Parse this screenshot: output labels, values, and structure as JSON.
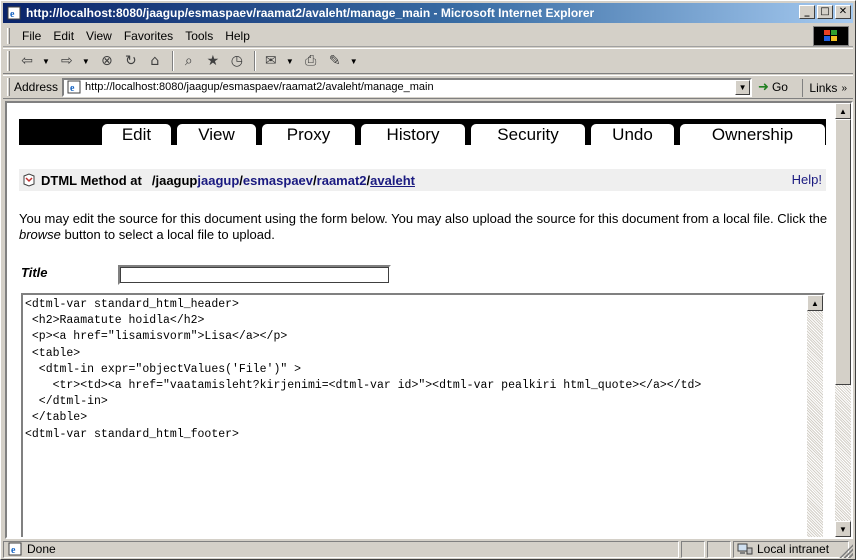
{
  "window": {
    "title": "http://localhost:8080/jaagup/esmaspaev/raamat2/avaleht/manage_main - Microsoft Internet Explorer",
    "buttons": {
      "minimize": "_",
      "maximize": "□",
      "close": "✕"
    }
  },
  "menubar": {
    "items": [
      "File",
      "Edit",
      "View",
      "Favorites",
      "Tools",
      "Help"
    ]
  },
  "toolbar": {
    "back": "⇦",
    "forward": "⇨",
    "stop": "⊗",
    "refresh": "↻",
    "home": "⌂",
    "search": "⌕",
    "favorites": "★",
    "history": "◷",
    "mail": "✉",
    "print": "⎙",
    "edit": "✎",
    "dropdown": "▼"
  },
  "addressbar": {
    "label": "Address",
    "url": "http://localhost:8080/jaagup/esmaspaev/raamat2/avaleht/manage_main",
    "go_label": "Go",
    "go_arrow": "➜",
    "links_label": "Links",
    "links_chevron": "»"
  },
  "tabs": [
    {
      "label": "Edit",
      "active": true
    },
    {
      "label": "View"
    },
    {
      "label": "Proxy"
    },
    {
      "label": "History"
    },
    {
      "label": "Security"
    },
    {
      "label": "Undo"
    },
    {
      "label": "Ownership"
    }
  ],
  "crumb": {
    "type_label": "DTML Method at",
    "path": [
      "/jaagup",
      "/esmaspaev",
      "/raamat2",
      "/"
    ],
    "path_parts": {
      "p1": "jaagup",
      "p2": "esmaspaev",
      "p3": "raamat2",
      "last": "avaleht"
    },
    "help": "Help!"
  },
  "instructions": {
    "line_a": "You may edit the source for this document using the form below. You may also upload the source for this document from a local file. Click the ",
    "browse_word": "browse",
    "line_b": " button to select a local file to upload."
  },
  "form": {
    "title_label": "Title",
    "title_value": "",
    "source_lines": [
      "<dtml-var standard_html_header>",
      " <h2>Raamatute hoidla</h2>",
      " <p><a href=\"lisamisvorm\">Lisa</a></p>",
      " <table>",
      "  <dtml-in expr=\"objectValues('File')\" >",
      "    <tr><td><a href=\"vaatamisleht?kirjenimi=<dtml-var id>\"><dtml-var pealkiri html_quote></a></td>",
      "  </dtml-in>",
      " </table>",
      "<dtml-var standard_html_footer>"
    ]
  },
  "statusbar": {
    "text": "Done",
    "zone": "Local intranet"
  },
  "colors": {
    "titlebar_start": "#0a246a",
    "titlebar_end": "#a6caf0",
    "link": "#1a1a80",
    "chrome": "#d4d0c8"
  }
}
